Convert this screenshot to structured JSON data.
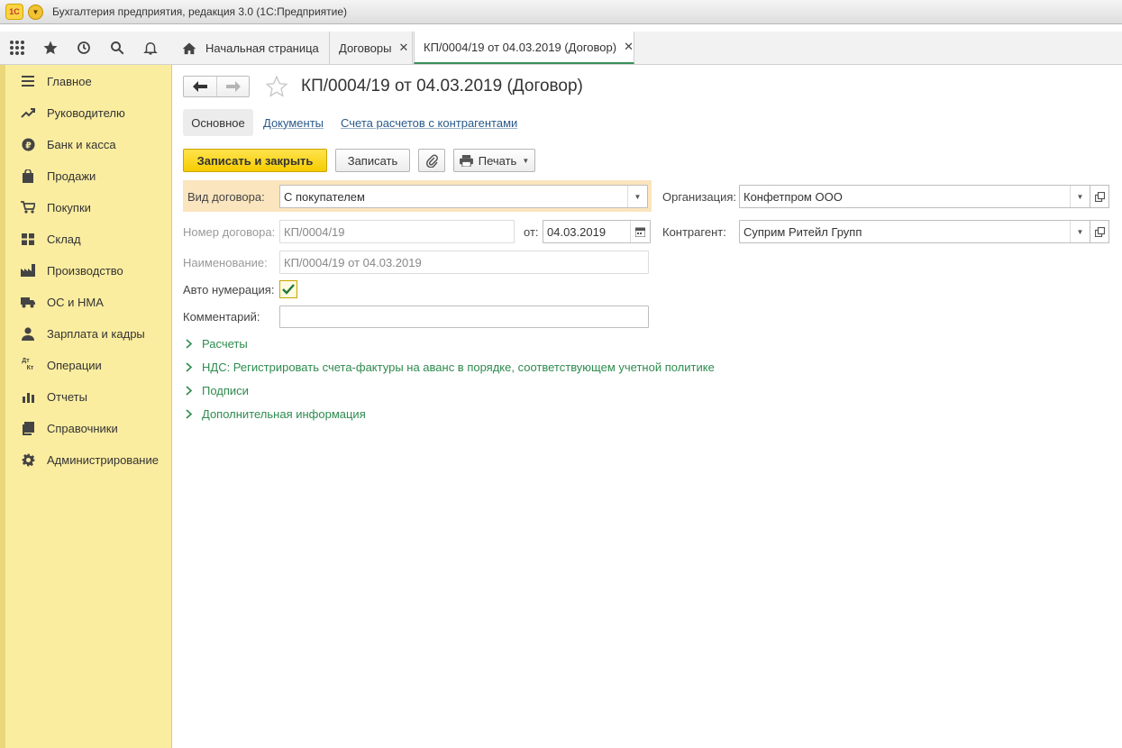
{
  "app": {
    "title": "Бухгалтерия предприятия, редакция 3.0  (1С:Предприятие)",
    "logo_text": "1С"
  },
  "tabs": {
    "home": "Начальная страница",
    "contracts": "Договоры",
    "active": "КП/0004/19 от 04.03.2019 (Договор)",
    "close_glyph": "✕"
  },
  "sidebar": {
    "items": [
      {
        "label": "Главное",
        "icon": "menu-lines-icon"
      },
      {
        "label": "Руководителю",
        "icon": "trend-arrow-icon"
      },
      {
        "label": "Банк и касса",
        "icon": "ruble-coin-icon"
      },
      {
        "label": "Продажи",
        "icon": "shopping-bag-icon"
      },
      {
        "label": "Покупки",
        "icon": "cart-icon"
      },
      {
        "label": "Склад",
        "icon": "warehouse-grid-icon"
      },
      {
        "label": "Производство",
        "icon": "factory-icon"
      },
      {
        "label": "ОС и НМА",
        "icon": "truck-icon"
      },
      {
        "label": "Зарплата и кадры",
        "icon": "person-icon"
      },
      {
        "label": "Операции",
        "icon": "dt-kt-icon"
      },
      {
        "label": "Отчеты",
        "icon": "bar-chart-icon"
      },
      {
        "label": "Справочники",
        "icon": "book-icon"
      },
      {
        "label": "Администрирование",
        "icon": "gear-icon"
      }
    ],
    "dtkt_glyph_top": "Дт",
    "dtkt_glyph_bottom": "Кт"
  },
  "document": {
    "title": "КП/0004/19 от 04.03.2019 (Договор)"
  },
  "subtabs": {
    "main": "Основное",
    "documents": "Документы",
    "accounts": "Счета расчетов с контрагентами"
  },
  "toolbar": {
    "save_close": "Записать и закрыть",
    "save": "Записать",
    "print": "Печать"
  },
  "form": {
    "contract_type_label": "Вид договора:",
    "contract_type_value": "С покупателем",
    "organization_label": "Организация:",
    "organization_value": "Конфетпром ООО",
    "number_label": "Номер договора:",
    "number_value": "КП/0004/19",
    "date_label": "от:",
    "date_value": "04.03.2019",
    "counterparty_label": "Контрагент:",
    "counterparty_value": "Суприм Ритейл Групп",
    "name_label": "Наименование:",
    "name_value": "КП/0004/19 от 04.03.2019",
    "autonum_label": "Авто нумерация:",
    "autonum_checked": true,
    "comment_label": "Комментарий:",
    "comment_value": ""
  },
  "groups": [
    "Расчеты",
    "НДС: Регистрировать счета-фактуры на аванс в порядке, соответствующем учетной политике",
    "Подписи",
    "Дополнительная информация"
  ],
  "colors": {
    "sidebar_bg": "#fbeda0",
    "primary_button": "#f5cc00",
    "group_link": "#2e8b4e",
    "link": "#2b5a8a",
    "active_tab_underline": "#3a8f5a"
  }
}
